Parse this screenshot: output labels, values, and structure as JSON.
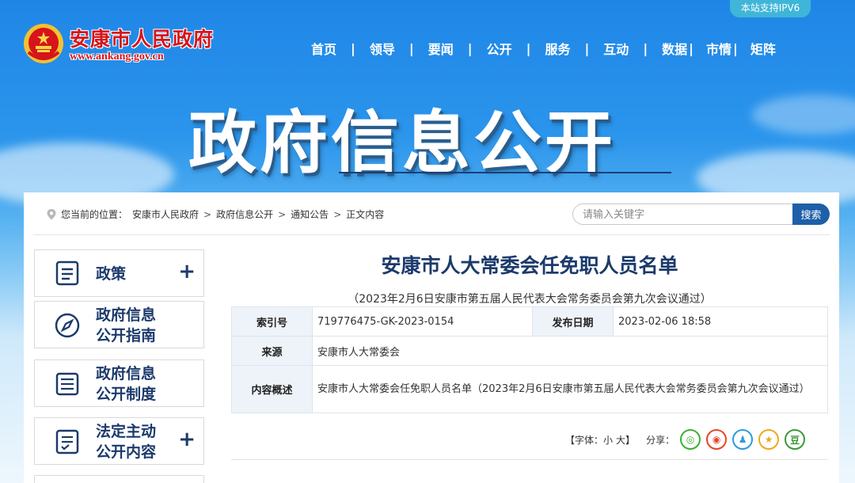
{
  "header": {
    "ipv6_badge": "本站支持IPV6",
    "site_name": "安康市人民政府",
    "site_url": "www.ankang.gov.cn",
    "nav": [
      {
        "label": "首页"
      },
      {
        "label": "领导"
      },
      {
        "label": "要闻"
      },
      {
        "label": "公开"
      },
      {
        "label": "服务"
      },
      {
        "label": "互动"
      },
      {
        "label": "数据"
      },
      {
        "label": "市情"
      },
      {
        "label": "矩阵"
      }
    ],
    "nav_sep": "|",
    "banner_title": "政府信息公开"
  },
  "breadcrumb": {
    "prefix": "您当前的位置：",
    "items": [
      "安康市人民政府",
      "政府信息公开",
      "通知公告",
      "正文内容"
    ],
    "separator": ">"
  },
  "search": {
    "placeholder": "请输入关键字",
    "button_label": "搜索"
  },
  "sidebar": {
    "items": [
      {
        "label": "政策",
        "icon": "document-icon",
        "expandable": true
      },
      {
        "label": "政府信息公开指南",
        "line1": "政府信息",
        "line2": "公开指南",
        "icon": "compass-icon",
        "expandable": false
      },
      {
        "label": "政府信息公开制度",
        "line1": "政府信息",
        "line2": "公开制度",
        "icon": "list-icon",
        "expandable": false
      },
      {
        "label": "法定主动公开内容",
        "line1": "法定主动",
        "line2": "公开内容",
        "icon": "checklist-icon",
        "expandable": true
      }
    ],
    "plus": "+"
  },
  "document": {
    "title": "安康市人大常委会任免职人员名单",
    "subtitle": "（2023年2月6日安康市第五届人民代表大会常务委员会第九次会议通过）",
    "meta": {
      "index_label": "索引号",
      "index_value": "719776475-GK-2023-0154",
      "date_label": "发布日期",
      "date_value": "2023-02-06 18:58",
      "source_label": "来源",
      "source_value": "安康市人大常委会",
      "summary_label": "内容概述",
      "summary_value": "安康市人大常委会任免职人员名单（2023年2月6日安康市第五届人民代表大会常务委员会第九次会议通过）"
    }
  },
  "tools": {
    "font_label": "【字体：",
    "font_small": "小",
    "font_large": "大",
    "font_close": "】",
    "share_label": "分享：",
    "share_items": [
      {
        "name": "wechat-icon",
        "glyph": "◎",
        "color": "#3cb034"
      },
      {
        "name": "weibo-icon",
        "glyph": "◉",
        "color": "#e5462c"
      },
      {
        "name": "qq-icon",
        "glyph": "♟",
        "color": "#2d9be0"
      },
      {
        "name": "qzone-icon",
        "glyph": "★",
        "color": "#f0a81e"
      },
      {
        "name": "douban-icon",
        "glyph": "豆",
        "color": "#3a9a3a"
      }
    ]
  },
  "colors": {
    "brand_red": "#d6141b",
    "nav_blue": "#1c3a6b",
    "search_button": "#1e5fa8"
  }
}
